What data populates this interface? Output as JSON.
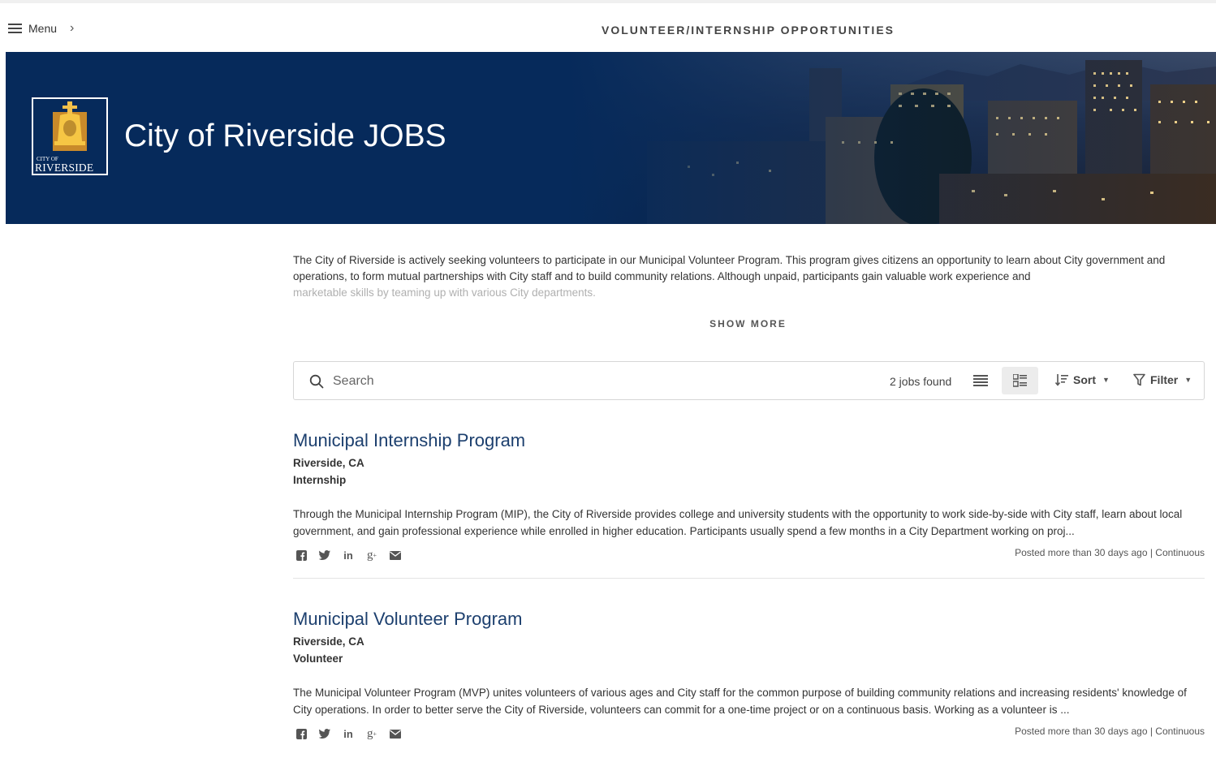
{
  "header": {
    "menu_label": "Menu",
    "page_heading": "VOLUNTEER/INTERNSHIP OPPORTUNITIES"
  },
  "banner": {
    "title": "City of Riverside JOBS",
    "logo_small_text": "CITY OF",
    "logo_name": "RIVERSIDE",
    "bg_color": "#062a5b"
  },
  "intro": {
    "text": "The City of Riverside is actively seeking volunteers to participate in our Municipal Volunteer Program. This program gives citizens an opportunity to learn about City government and operations, to form mutual partnerships with City staff and to build community relations. Although unpaid, participants gain valuable work experience and",
    "faded_text": "marketable skills by teaming up with various City departments.",
    "show_more_label": "SHOW MORE"
  },
  "search": {
    "placeholder": "Search",
    "jobs_found": "2 jobs found",
    "sort_label": "Sort",
    "filter_label": "Filter"
  },
  "jobs": [
    {
      "title": "Municipal Internship Program",
      "location": "Riverside, CA",
      "type": "Internship",
      "description": "Through the Municipal Internship Program (MIP), the City of Riverside provides college and university students with the opportunity to work side-by-side with City staff, learn about local government, and gain professional experience while enrolled in higher education. Participants usually spend a few months in a City Department working on proj...",
      "posted": "Posted more than 30 days ago | Continuous"
    },
    {
      "title": "Municipal Volunteer Program",
      "location": "Riverside, CA",
      "type": "Volunteer",
      "description": "The Municipal Volunteer Program (MVP) unites volunteers of various ages and City staff for the common purpose of building community relations and increasing residents' knowledge of City operations. In order to better serve the City of Riverside, volunteers can commit for a one-time project or on a continuous basis. Working as a volunteer is ...",
      "posted": "Posted more than 30 days ago | Continuous"
    }
  ],
  "share_icons": [
    "facebook-icon",
    "twitter-icon",
    "linkedin-icon",
    "google-plus-icon",
    "email-icon"
  ],
  "colors": {
    "accent": "#1c3f6e",
    "banner": "#062a5b"
  }
}
